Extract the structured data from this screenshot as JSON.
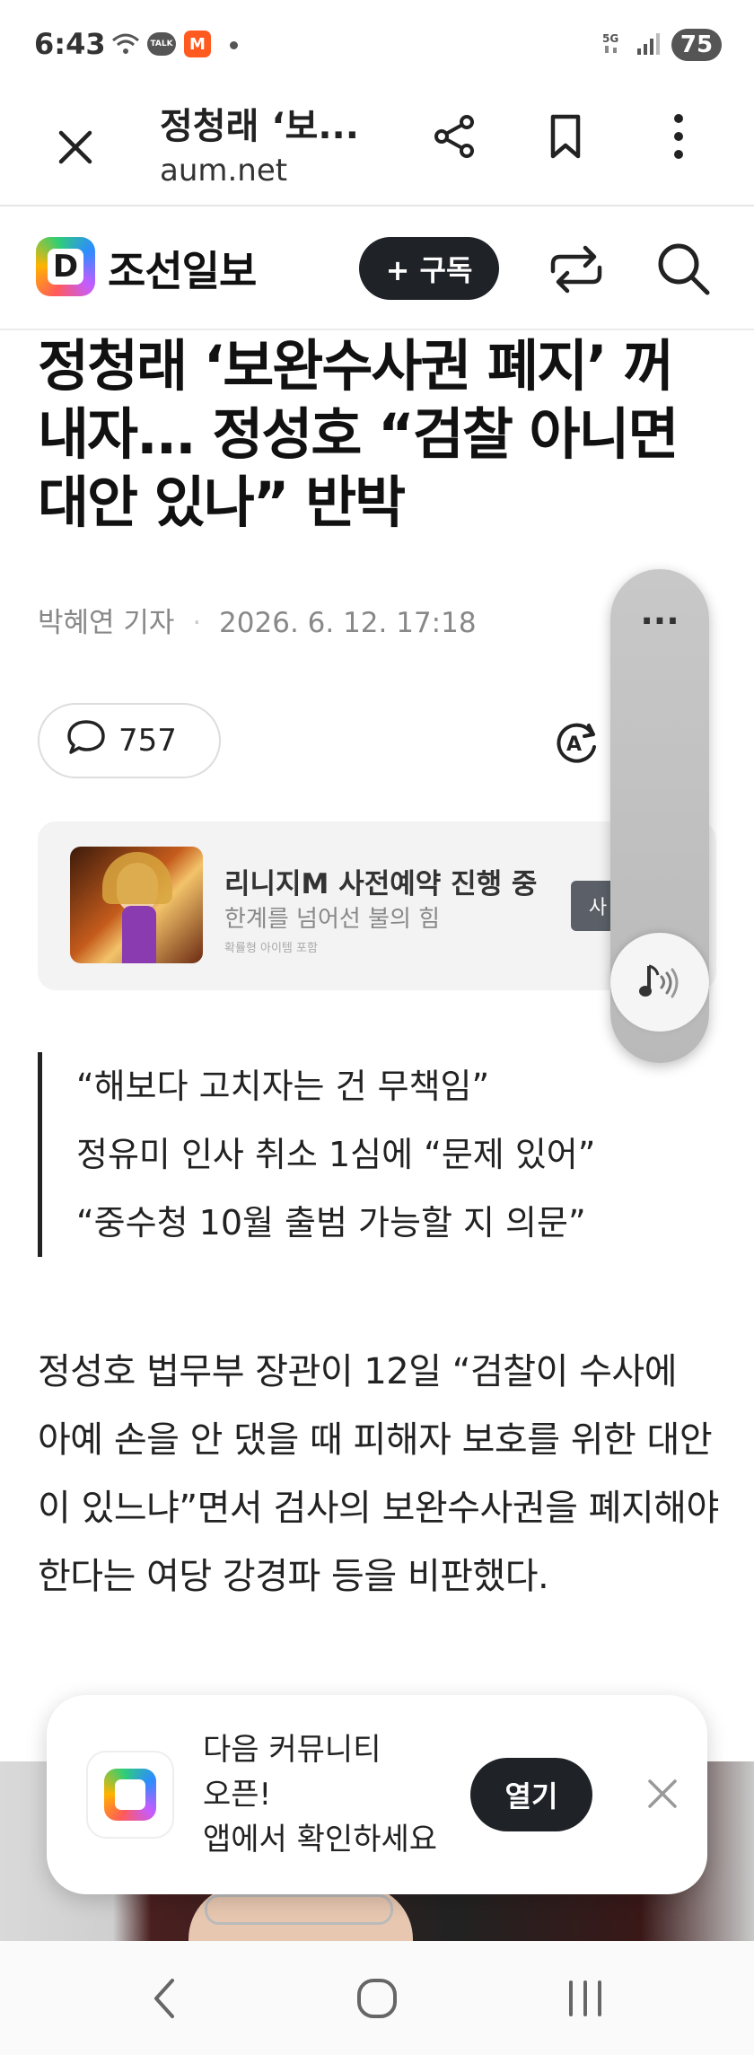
{
  "status": {
    "time": "6:43",
    "battery": "75",
    "network": "5G"
  },
  "browser": {
    "title": "정청래 ‘보...",
    "url": "aum.net"
  },
  "site": {
    "paper_name": "조선일보",
    "subscribe_label": "+ 구독"
  },
  "article": {
    "headline": "정청래 ‘보완수사권 폐지’ 꺼내자... 정성호 “검찰 아니면 대안 있나” 반박",
    "author": "박혜연 기자",
    "date": "2026. 6. 12. 17:18",
    "comment_count": "757",
    "quotes": [
      "“해보다 고치자는 건 무책임”",
      "정유미 인사 취소 1심에 “문제 있어”",
      "“중수청 10월 출범 가능할 지 의문”"
    ],
    "body": "정성호 법무부 장관이 12일 “검찰이 수사에 아예 손을 안 댔을 때 피해자 보호를 위한 대안이 있느냐”면서 검사의 보완수사권을 폐지해야 한다는 여당 강경파 등을 비판했다."
  },
  "ad": {
    "title": "리니지M 사전예약 진행 중",
    "subtitle": "한계를 넘어선 불의 힘",
    "note": "확률형 아이템 포함",
    "button": "사"
  },
  "float_panel": {
    "more": "..."
  },
  "banner": {
    "line1": "다음 커뮤니티",
    "line2": "오픈!",
    "line3": "앱에서 확인하세요",
    "open_label": "열기"
  }
}
